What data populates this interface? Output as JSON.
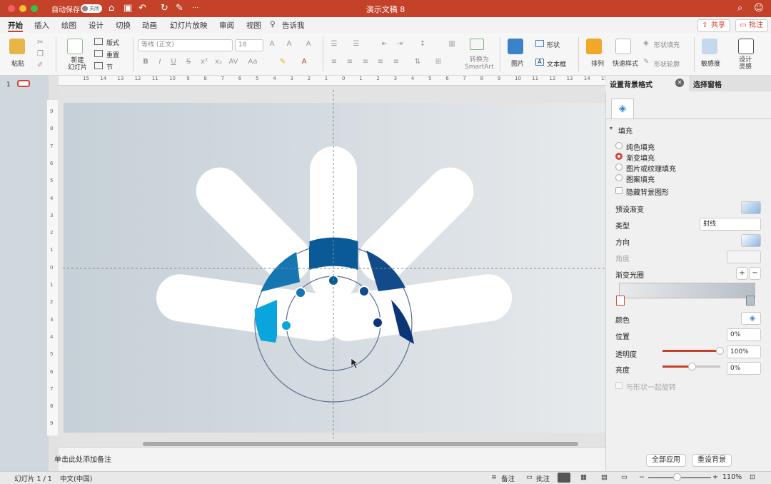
{
  "titlebar": {
    "autosave": "自动保存",
    "toggle": "关闭",
    "doc_title": "演示文稿 8"
  },
  "tabs": [
    "开始",
    "插入",
    "绘图",
    "设计",
    "切换",
    "动画",
    "幻灯片放映",
    "审阅",
    "视图"
  ],
  "tell_me": "告诉我",
  "share": "共享",
  "comments": "批注",
  "ribbon": {
    "paste": "粘贴",
    "new_slide": "新建\n幻灯片",
    "layout": "版式",
    "reset": "重置",
    "section": "节",
    "font": "等线 (正文)",
    "size": "18",
    "convert": "转换为\nSmartArt",
    "picture": "图片",
    "shape": "形状",
    "textbox": "文本框",
    "arrange": "排列",
    "quick_styles": "快速样式",
    "shape_fill": "形状填充",
    "shape_outline": "形状轮廓",
    "sensitivity": "敏感度",
    "designer": "设计\n灵感"
  },
  "ruler": {
    "h": [
      "15",
      "14",
      "13",
      "12",
      "11",
      "10",
      "9",
      "8",
      "7",
      "6",
      "5",
      "4",
      "3",
      "2",
      "1",
      "0",
      "1",
      "2",
      "3",
      "4",
      "5",
      "6",
      "7",
      "8",
      "9",
      "10",
      "11",
      "12",
      "13",
      "14",
      "15"
    ],
    "v": [
      "9",
      "8",
      "7",
      "6",
      "5",
      "4",
      "3",
      "2",
      "1",
      "0",
      "1",
      "2",
      "3",
      "4",
      "5",
      "6",
      "7",
      "8",
      "9"
    ]
  },
  "slide_number": "1",
  "notes": "单击此处添加备注",
  "pane": {
    "title": "设置背景格式",
    "tab2": "选择窗格",
    "section": "填充",
    "options": [
      "纯色填充",
      "渐变填充",
      "图片或纹理填充",
      "图案填充"
    ],
    "selected_option": "渐变填充",
    "hide_bg": "隐藏背景图形",
    "preset": "预设渐变",
    "type": "类型",
    "type_value": "射线",
    "direction": "方向",
    "angle": "角度",
    "stops": "渐变光圈",
    "color": "颜色",
    "position": "位置",
    "position_value": "0%",
    "transparency": "透明度",
    "transparency_value": "100%",
    "brightness": "亮度",
    "brightness_value": "0%",
    "rotate": "与形状一起旋转",
    "apply_all": "全部应用",
    "reset_bg": "重设背景",
    "transparency_level": 1.0,
    "brightness_level": 0.5
  },
  "status": {
    "slide": "幻灯片 1 / 1",
    "lang": "中文(中国)",
    "notes": "备注",
    "comments": "批注",
    "zoom": "110%"
  },
  "colors": {
    "accent": "#c4422a",
    "shape1": "#0aa5dd",
    "shape2": "#1576b2",
    "shape3": "#0b5a98",
    "shape4": "#124a8a",
    "shape5": "#0c3578"
  }
}
